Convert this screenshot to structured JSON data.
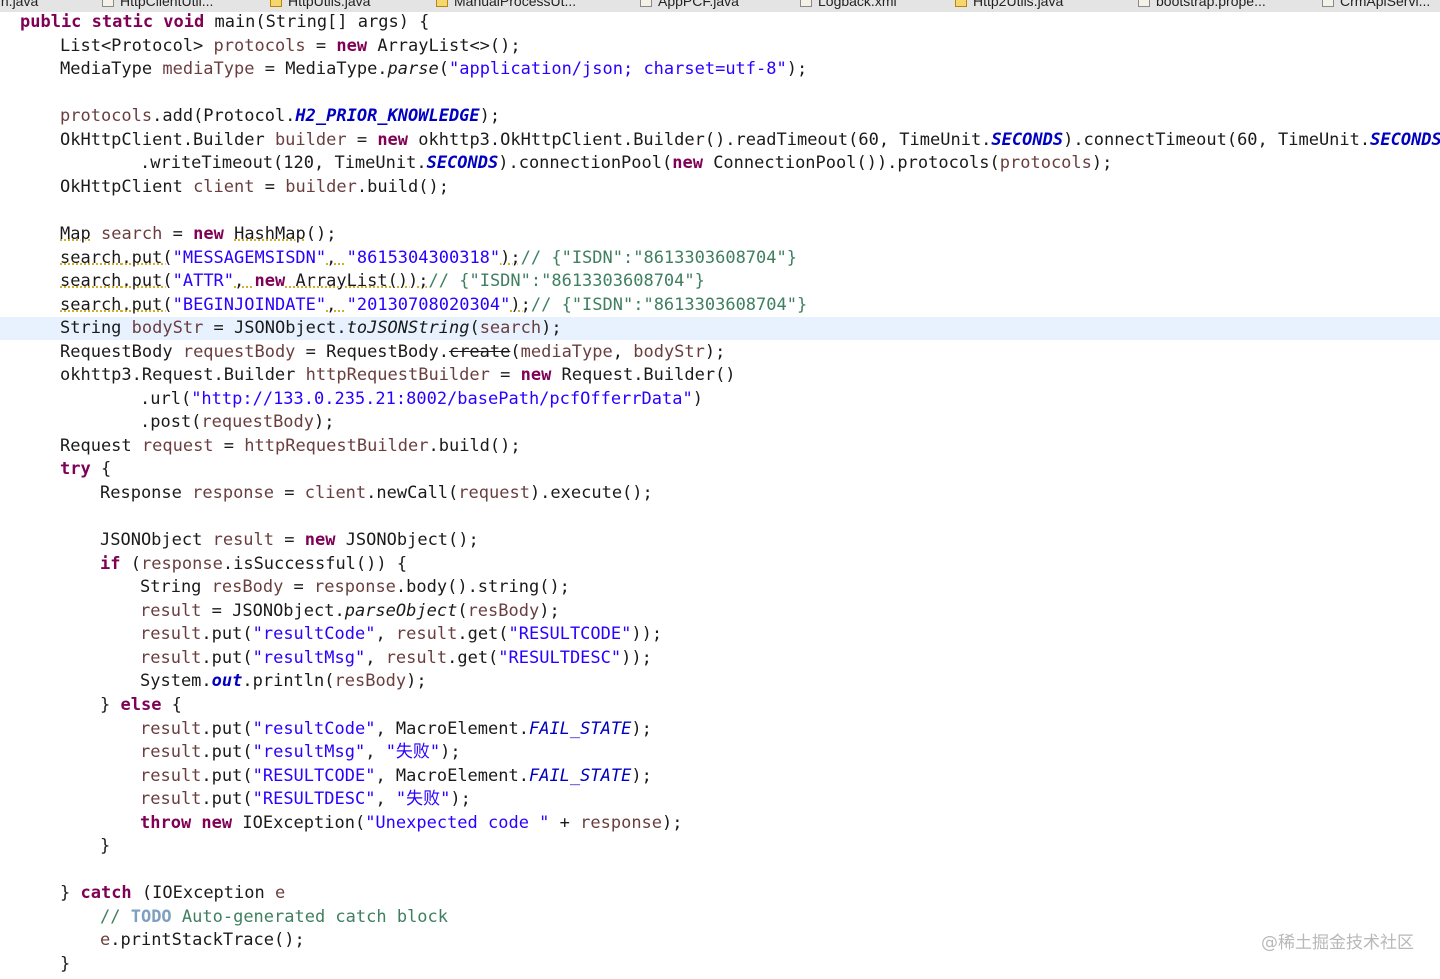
{
  "tabs": [
    {
      "label": "ain.java",
      "warn": false
    },
    {
      "label": "HttpClientUtil...",
      "warn": false
    },
    {
      "label": "HttpUtils.java",
      "warn": true
    },
    {
      "label": "ManualProcessUt...",
      "warn": true
    },
    {
      "label": "AppPCF.java",
      "warn": false
    },
    {
      "label": "Logback.xml",
      "warn": false
    },
    {
      "label": "Http2Utils.java",
      "warn": true
    },
    {
      "label": "bootstrap.prope...",
      "warn": false
    },
    {
      "label": "CrmApiServi...",
      "warn": false
    }
  ],
  "current_line": 13,
  "lines": [
    {
      "indent": 0,
      "tokens": [
        [
          "kw",
          "public static void "
        ],
        [
          "",
          "main(String[] args) {"
        ]
      ]
    },
    {
      "indent": 1,
      "tokens": [
        [
          "",
          "List<Protocol> "
        ],
        [
          "loc",
          "protocols"
        ],
        [
          "",
          " = "
        ],
        [
          "kw",
          "new"
        ],
        [
          "",
          " ArrayList<>();"
        ]
      ]
    },
    {
      "indent": 1,
      "tokens": [
        [
          "",
          "MediaType "
        ],
        [
          "loc",
          "mediaType"
        ],
        [
          "",
          " = MediaType."
        ],
        [
          "ital",
          "parse"
        ],
        [
          "",
          "("
        ],
        [
          "str",
          "\"application/json; charset=utf-8\""
        ],
        [
          "",
          ");"
        ]
      ]
    },
    {
      "indent": 0,
      "tokens": []
    },
    {
      "indent": 1,
      "tokens": [
        [
          "loc",
          "protocols"
        ],
        [
          "",
          ".add(Protocol."
        ],
        [
          "fld",
          "H2_PRIOR_KNOWLEDGE"
        ],
        [
          "",
          ");"
        ]
      ]
    },
    {
      "indent": 1,
      "tokens": [
        [
          "",
          "OkHttpClient.Builder "
        ],
        [
          "loc",
          "builder"
        ],
        [
          "",
          " = "
        ],
        [
          "kw",
          "new"
        ],
        [
          "",
          " okhttp3.OkHttpClient.Builder().readTimeout(60, TimeUnit."
        ],
        [
          "fld",
          "SECONDS"
        ],
        [
          "",
          ").connectTimeout(60, TimeUnit."
        ],
        [
          "fld",
          "SECONDS"
        ],
        [
          "",
          ")"
        ]
      ]
    },
    {
      "indent": 3,
      "tokens": [
        [
          "",
          ".writeTimeout(120, TimeUnit."
        ],
        [
          "fld",
          "SECONDS"
        ],
        [
          "",
          ").connectionPool("
        ],
        [
          "kw",
          "new"
        ],
        [
          "",
          " ConnectionPool()).protocols("
        ],
        [
          "loc",
          "protocols"
        ],
        [
          "",
          ");"
        ]
      ]
    },
    {
      "indent": 1,
      "tokens": [
        [
          "",
          "OkHttpClient "
        ],
        [
          "loc",
          "client"
        ],
        [
          "",
          " = "
        ],
        [
          "loc",
          "builder"
        ],
        [
          "",
          ".build();"
        ]
      ]
    },
    {
      "indent": 0,
      "tokens": []
    },
    {
      "indent": 1,
      "tokens": [
        [
          "warnu",
          "Map"
        ],
        [
          "",
          " "
        ],
        [
          "loc",
          "search"
        ],
        [
          "",
          " = "
        ],
        [
          "kw",
          "new"
        ],
        [
          "",
          " "
        ],
        [
          "warnu",
          "HashMap"
        ],
        [
          "",
          "();"
        ]
      ]
    },
    {
      "indent": 1,
      "tokens": [
        [
          "warnu",
          "search"
        ],
        [
          "warnu",
          ".put("
        ],
        [
          "str",
          "\"MESSAGEMSISDN\""
        ],
        [
          "warnu",
          ", "
        ],
        [
          "str",
          "\"8615304300318\""
        ],
        [
          "warnu",
          ");"
        ],
        [
          "cmt",
          "// {\"ISDN\":\"8613303608704\"}"
        ]
      ]
    },
    {
      "indent": 1,
      "tokens": [
        [
          "warnu",
          "search"
        ],
        [
          "warnu",
          ".put("
        ],
        [
          "str",
          "\"ATTR\""
        ],
        [
          "warnu",
          ", "
        ],
        [
          "kw",
          "new"
        ],
        [
          "warnu",
          " ArrayList());"
        ],
        [
          "cmt",
          "// {\"ISDN\":\"8613303608704\"}"
        ]
      ]
    },
    {
      "indent": 1,
      "tokens": [
        [
          "warnu",
          "search"
        ],
        [
          "warnu",
          ".put("
        ],
        [
          "str",
          "\"BEGINJOINDATE\""
        ],
        [
          "warnu",
          ", "
        ],
        [
          "str",
          "\"20130708020304\""
        ],
        [
          "warnu",
          ");"
        ],
        [
          "cmt",
          "// {\"ISDN\":\"8613303608704\"}"
        ]
      ]
    },
    {
      "indent": 1,
      "tokens": [
        [
          "",
          "String "
        ],
        [
          "loc",
          "bodyStr"
        ],
        [
          "",
          " = JSONObject."
        ],
        [
          "ital",
          "toJSONString"
        ],
        [
          "",
          "("
        ],
        [
          "loc",
          "search"
        ],
        [
          "",
          ");"
        ]
      ]
    },
    {
      "indent": 1,
      "tokens": [
        [
          "",
          "RequestBody "
        ],
        [
          "loc",
          "requestBody"
        ],
        [
          "",
          " = RequestBody."
        ],
        [
          "dep",
          "create"
        ],
        [
          "",
          "("
        ],
        [
          "loc",
          "mediaType"
        ],
        [
          "",
          ", "
        ],
        [
          "loc",
          "bodyStr"
        ],
        [
          "",
          ");"
        ]
      ]
    },
    {
      "indent": 1,
      "tokens": [
        [
          "",
          "okhttp3.Request.Builder "
        ],
        [
          "loc",
          "httpRequestBuilder"
        ],
        [
          "",
          " = "
        ],
        [
          "kw",
          "new"
        ],
        [
          "",
          " Request.Builder()"
        ]
      ]
    },
    {
      "indent": 3,
      "tokens": [
        [
          "",
          ".url("
        ],
        [
          "str",
          "\"http://133.0.235.21:8002/basePath/pcfOfferrData\""
        ],
        [
          "",
          ")"
        ]
      ]
    },
    {
      "indent": 3,
      "tokens": [
        [
          "",
          ".post("
        ],
        [
          "loc",
          "requestBody"
        ],
        [
          "",
          ");"
        ]
      ]
    },
    {
      "indent": 1,
      "tokens": [
        [
          "",
          "Request "
        ],
        [
          "loc",
          "request"
        ],
        [
          "",
          " = "
        ],
        [
          "loc",
          "httpRequestBuilder"
        ],
        [
          "",
          ".build();"
        ]
      ]
    },
    {
      "indent": 1,
      "tokens": [
        [
          "kw",
          "try"
        ],
        [
          "",
          " {"
        ]
      ]
    },
    {
      "indent": 2,
      "tokens": [
        [
          "",
          "Response "
        ],
        [
          "loc",
          "response"
        ],
        [
          "",
          " = "
        ],
        [
          "loc",
          "client"
        ],
        [
          "",
          ".newCall("
        ],
        [
          "loc",
          "request"
        ],
        [
          "",
          ").execute();"
        ]
      ]
    },
    {
      "indent": 0,
      "tokens": []
    },
    {
      "indent": 2,
      "tokens": [
        [
          "",
          "JSONObject "
        ],
        [
          "loc",
          "result"
        ],
        [
          "",
          " = "
        ],
        [
          "kw",
          "new"
        ],
        [
          "",
          " JSONObject();"
        ]
      ]
    },
    {
      "indent": 2,
      "tokens": [
        [
          "kw",
          "if"
        ],
        [
          "",
          " ("
        ],
        [
          "loc",
          "response"
        ],
        [
          "",
          ".isSuccessful()) {"
        ]
      ]
    },
    {
      "indent": 3,
      "tokens": [
        [
          "",
          "String "
        ],
        [
          "loc",
          "resBody"
        ],
        [
          "",
          " = "
        ],
        [
          "loc",
          "response"
        ],
        [
          "",
          ".body().string();"
        ]
      ]
    },
    {
      "indent": 3,
      "tokens": [
        [
          "loc",
          "result"
        ],
        [
          "",
          " = JSONObject."
        ],
        [
          "ital",
          "parseObject"
        ],
        [
          "",
          "("
        ],
        [
          "loc",
          "resBody"
        ],
        [
          "",
          ");"
        ]
      ]
    },
    {
      "indent": 3,
      "tokens": [
        [
          "loc",
          "result"
        ],
        [
          "",
          ".put("
        ],
        [
          "str",
          "\"resultCode\""
        ],
        [
          "",
          ", "
        ],
        [
          "loc",
          "result"
        ],
        [
          "",
          ".get("
        ],
        [
          "str",
          "\"RESULTCODE\""
        ],
        [
          "",
          "));"
        ]
      ]
    },
    {
      "indent": 3,
      "tokens": [
        [
          "loc",
          "result"
        ],
        [
          "",
          ".put("
        ],
        [
          "str",
          "\"resultMsg\""
        ],
        [
          "",
          ", "
        ],
        [
          "loc",
          "result"
        ],
        [
          "",
          ".get("
        ],
        [
          "str",
          "\"RESULTDESC\""
        ],
        [
          "",
          "));"
        ]
      ]
    },
    {
      "indent": 3,
      "tokens": [
        [
          "",
          "System."
        ],
        [
          "fld",
          "out"
        ],
        [
          "",
          ".println("
        ],
        [
          "loc",
          "resBody"
        ],
        [
          "",
          ");"
        ]
      ]
    },
    {
      "indent": 2,
      "tokens": [
        [
          "",
          "} "
        ],
        [
          "kw",
          "else"
        ],
        [
          "",
          " {"
        ]
      ]
    },
    {
      "indent": 3,
      "tokens": [
        [
          "loc",
          "result"
        ],
        [
          "",
          ".put("
        ],
        [
          "str",
          "\"resultCode\""
        ],
        [
          "",
          ", MacroElement."
        ],
        [
          "sfld",
          "FAIL_STATE"
        ],
        [
          "",
          ");"
        ]
      ]
    },
    {
      "indent": 3,
      "tokens": [
        [
          "loc",
          "result"
        ],
        [
          "",
          ".put("
        ],
        [
          "str",
          "\"resultMsg\""
        ],
        [
          "",
          ", "
        ],
        [
          "str",
          "\"失败\""
        ],
        [
          "",
          ");"
        ]
      ]
    },
    {
      "indent": 3,
      "tokens": [
        [
          "loc",
          "result"
        ],
        [
          "",
          ".put("
        ],
        [
          "str",
          "\"RESULTCODE\""
        ],
        [
          "",
          ", MacroElement."
        ],
        [
          "sfld",
          "FAIL_STATE"
        ],
        [
          "",
          ");"
        ]
      ]
    },
    {
      "indent": 3,
      "tokens": [
        [
          "loc",
          "result"
        ],
        [
          "",
          ".put("
        ],
        [
          "str",
          "\"RESULTDESC\""
        ],
        [
          "",
          ", "
        ],
        [
          "str",
          "\"失败\""
        ],
        [
          "",
          ");"
        ]
      ]
    },
    {
      "indent": 3,
      "tokens": [
        [
          "kw",
          "throw new"
        ],
        [
          "",
          " IOException("
        ],
        [
          "str",
          "\"Unexpected code \""
        ],
        [
          "",
          " + "
        ],
        [
          "loc",
          "response"
        ],
        [
          "",
          ");"
        ]
      ]
    },
    {
      "indent": 2,
      "tokens": [
        [
          "",
          "}"
        ]
      ]
    },
    {
      "indent": 0,
      "tokens": []
    },
    {
      "indent": 1,
      "tokens": [
        [
          "",
          "} "
        ],
        [
          "kw",
          "catch"
        ],
        [
          "",
          " (IOException "
        ],
        [
          "loc",
          "e"
        ],
        [
          ") {"
        ]
      ]
    },
    {
      "indent": 2,
      "tokens": [
        [
          "cmt",
          "// "
        ],
        [
          "todo",
          "TODO"
        ],
        [
          "cmt",
          " Auto-generated catch block"
        ]
      ]
    },
    {
      "indent": 2,
      "tokens": [
        [
          "loc",
          "e"
        ],
        [
          "",
          ".printStackTrace();"
        ]
      ]
    },
    {
      "indent": 1,
      "tokens": [
        [
          "",
          "}"
        ]
      ]
    }
  ],
  "watermark": "@稀土掘金技术社区"
}
